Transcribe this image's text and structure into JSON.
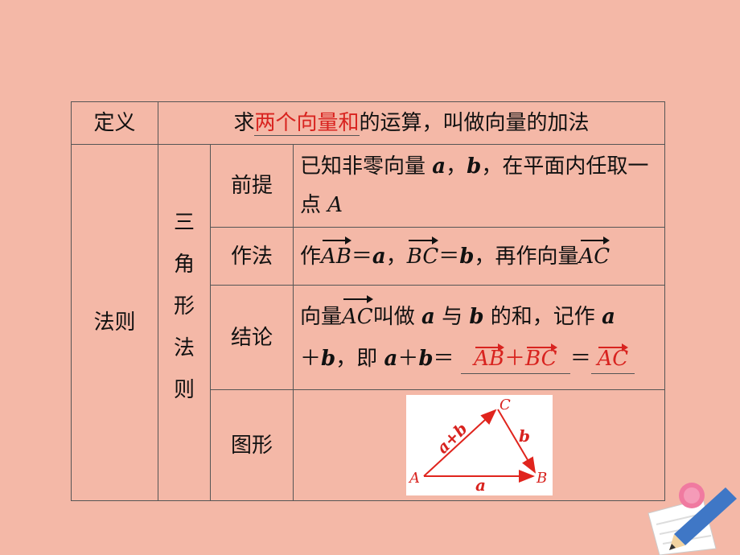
{
  "table": {
    "def_label": "定义",
    "def_prefix": "求",
    "def_highlight": "两个向量和",
    "def_suffix": "的运算，叫做向量的加法",
    "rule_label": "法则",
    "tri_chars": [
      "三",
      "角",
      "形",
      "法",
      "则"
    ],
    "premise": {
      "label": "前提",
      "text_1": "已知非零向量 ",
      "a": "a",
      "sep_1": "，",
      "b": "b",
      "text_2": "，在平面内任取一点 ",
      "A": "A"
    },
    "construct": {
      "label": "作法",
      "t1": "作",
      "AB": "AB",
      "eq1": "＝",
      "a": "a",
      "sep": "，",
      "BC": "BC",
      "eq2": "＝",
      "b": "b",
      "t2": "，再作向量",
      "AC": "AC"
    },
    "conclusion": {
      "label": "结论",
      "t1": "向量",
      "AC": "AC",
      "t2": "叫做 ",
      "a": "a",
      "t3": " 与 ",
      "b": "b",
      "t4": " 的和，记作 ",
      "a2": "a",
      "plus": "＋",
      "b2": "b",
      "t5": "，即 ",
      "a3": "a",
      "plus2": "＋",
      "b3": "b",
      "eq": "＝",
      "ans1_AB": "AB",
      "ans1_plus": "＋",
      "ans1_BC": "BC",
      "eq2": "＝",
      "ans2_AC": "AC"
    },
    "figure": {
      "label": "图形",
      "A": "A",
      "B": "B",
      "C": "C",
      "side_a": "a",
      "side_b": "b",
      "side_ab": "a+b"
    }
  },
  "colors": {
    "background": "#f4b8a7",
    "accent_red": "#d8231f",
    "border": "#555555"
  }
}
